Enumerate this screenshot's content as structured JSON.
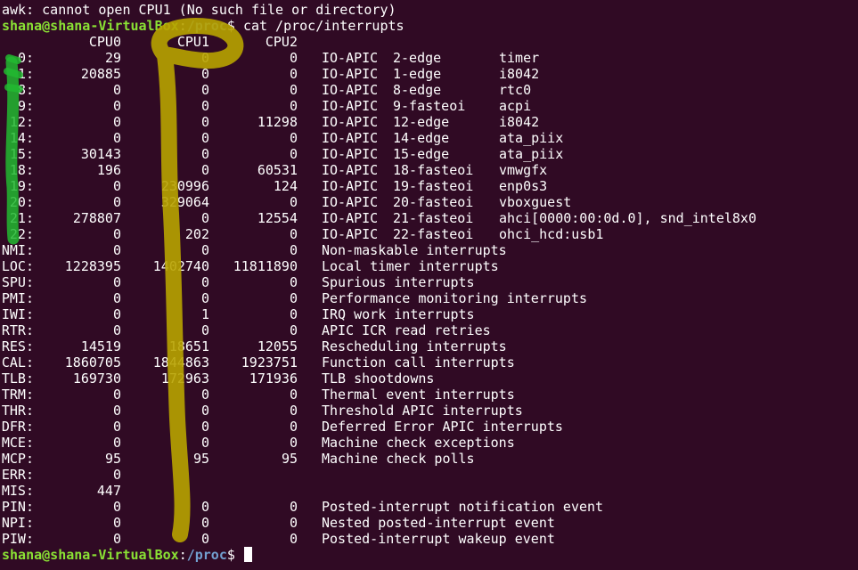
{
  "terminal": {
    "error_line": "awk: cannot open CPU1 (No such file or directory)",
    "prompt1": {
      "user_host": "shana@shana-VirtualBox",
      "sep": ":",
      "path": "/proc",
      "symbol": "$ ",
      "command": "cat /proc/interrupts"
    },
    "prompt2": {
      "user_host": "shana@shana-VirtualBox",
      "sep": ":",
      "path": "/proc",
      "symbol": "$ "
    },
    "headers": [
      "CPU0",
      "CPU1",
      "CPU2"
    ],
    "rows": [
      {
        "irq": "0:",
        "cpu0": "29",
        "cpu1": "0",
        "cpu2": "0",
        "ctrl": "IO-APIC",
        "type": "2-edge",
        "dev": "timer"
      },
      {
        "irq": "1:",
        "cpu0": "20885",
        "cpu1": "0",
        "cpu2": "0",
        "ctrl": "IO-APIC",
        "type": "1-edge",
        "dev": "i8042"
      },
      {
        "irq": "8:",
        "cpu0": "0",
        "cpu1": "0",
        "cpu2": "0",
        "ctrl": "IO-APIC",
        "type": "8-edge",
        "dev": "rtc0"
      },
      {
        "irq": "9:",
        "cpu0": "0",
        "cpu1": "0",
        "cpu2": "0",
        "ctrl": "IO-APIC",
        "type": "9-fasteoi",
        "dev": "acpi"
      },
      {
        "irq": "12:",
        "cpu0": "0",
        "cpu1": "0",
        "cpu2": "11298",
        "ctrl": "IO-APIC",
        "type": "12-edge",
        "dev": "i8042"
      },
      {
        "irq": "14:",
        "cpu0": "0",
        "cpu1": "0",
        "cpu2": "0",
        "ctrl": "IO-APIC",
        "type": "14-edge",
        "dev": "ata_piix"
      },
      {
        "irq": "15:",
        "cpu0": "30143",
        "cpu1": "0",
        "cpu2": "0",
        "ctrl": "IO-APIC",
        "type": "15-edge",
        "dev": "ata_piix"
      },
      {
        "irq": "18:",
        "cpu0": "196",
        "cpu1": "0",
        "cpu2": "60531",
        "ctrl": "IO-APIC",
        "type": "18-fasteoi",
        "dev": "vmwgfx"
      },
      {
        "irq": "19:",
        "cpu0": "0",
        "cpu1": "230996",
        "cpu2": "124",
        "ctrl": "IO-APIC",
        "type": "19-fasteoi",
        "dev": "enp0s3"
      },
      {
        "irq": "20:",
        "cpu0": "0",
        "cpu1": "329064",
        "cpu2": "0",
        "ctrl": "IO-APIC",
        "type": "20-fasteoi",
        "dev": "vboxguest"
      },
      {
        "irq": "21:",
        "cpu0": "278807",
        "cpu1": "0",
        "cpu2": "12554",
        "ctrl": "IO-APIC",
        "type": "21-fasteoi",
        "dev": "ahci[0000:00:0d.0], snd_intel8x0"
      },
      {
        "irq": "22:",
        "cpu0": "0",
        "cpu1": "202",
        "cpu2": "0",
        "ctrl": "IO-APIC",
        "type": "22-fasteoi",
        "dev": "ohci_hcd:usb1"
      },
      {
        "irq": "NMI:",
        "cpu0": "0",
        "cpu1": "0",
        "cpu2": "0",
        "desc": "Non-maskable interrupts"
      },
      {
        "irq": "LOC:",
        "cpu0": "1228395",
        "cpu1": "1402740",
        "cpu2": "11811890",
        "desc": "Local timer interrupts"
      },
      {
        "irq": "SPU:",
        "cpu0": "0",
        "cpu1": "0",
        "cpu2": "0",
        "desc": "Spurious interrupts"
      },
      {
        "irq": "PMI:",
        "cpu0": "0",
        "cpu1": "0",
        "cpu2": "0",
        "desc": "Performance monitoring interrupts"
      },
      {
        "irq": "IWI:",
        "cpu0": "0",
        "cpu1": "1",
        "cpu2": "0",
        "desc": "IRQ work interrupts"
      },
      {
        "irq": "RTR:",
        "cpu0": "0",
        "cpu1": "0",
        "cpu2": "0",
        "desc": "APIC ICR read retries"
      },
      {
        "irq": "RES:",
        "cpu0": "14519",
        "cpu1": "18651",
        "cpu2": "12055",
        "desc": "Rescheduling interrupts"
      },
      {
        "irq": "CAL:",
        "cpu0": "1860705",
        "cpu1": "1844863",
        "cpu2": "1923751",
        "desc": "Function call interrupts"
      },
      {
        "irq": "TLB:",
        "cpu0": "169730",
        "cpu1": "172963",
        "cpu2": "171936",
        "desc": "TLB shootdowns"
      },
      {
        "irq": "TRM:",
        "cpu0": "0",
        "cpu1": "0",
        "cpu2": "0",
        "desc": "Thermal event interrupts"
      },
      {
        "irq": "THR:",
        "cpu0": "0",
        "cpu1": "0",
        "cpu2": "0",
        "desc": "Threshold APIC interrupts"
      },
      {
        "irq": "DFR:",
        "cpu0": "0",
        "cpu1": "0",
        "cpu2": "0",
        "desc": "Deferred Error APIC interrupts"
      },
      {
        "irq": "MCE:",
        "cpu0": "0",
        "cpu1": "0",
        "cpu2": "0",
        "desc": "Machine check exceptions"
      },
      {
        "irq": "MCP:",
        "cpu0": "95",
        "cpu1": "95",
        "cpu2": "95",
        "desc": "Machine check polls"
      },
      {
        "irq": "ERR:",
        "cpu0": "0"
      },
      {
        "irq": "MIS:",
        "cpu0": "447"
      },
      {
        "irq": "PIN:",
        "cpu0": "0",
        "cpu1": "0",
        "cpu2": "0",
        "desc": "Posted-interrupt notification event"
      },
      {
        "irq": "NPI:",
        "cpu0": "0",
        "cpu1": "0",
        "cpu2": "0",
        "desc": "Nested posted-interrupt event"
      },
      {
        "irq": "PIW:",
        "cpu0": "0",
        "cpu1": "0",
        "cpu2": "0",
        "desc": "Posted-interrupt wakeup event"
      }
    ],
    "colors": {
      "background": "#300a24",
      "text": "#ffffff",
      "prompt_user": "#8ae234",
      "prompt_path": "#729fcf",
      "highlight_green": "#22b830",
      "highlight_yellow": "#b8a300"
    }
  }
}
